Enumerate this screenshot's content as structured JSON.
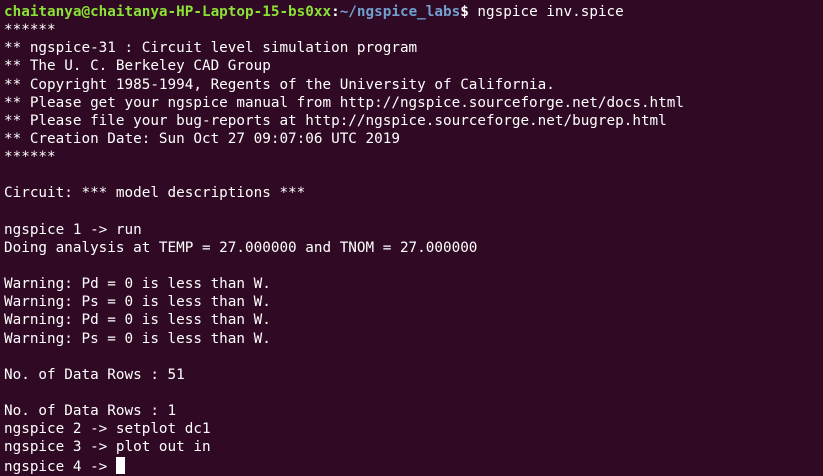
{
  "shell": {
    "user_host": "chaitanya@chaitanya-HP-Laptop-15-bs0xx",
    "separator": ":",
    "path": "~/ngspice_labs",
    "dollar": "$",
    "command": " ngspice inv.spice"
  },
  "output_lines": [
    "******",
    "** ngspice-31 : Circuit level simulation program",
    "** The U. C. Berkeley CAD Group",
    "** Copyright 1985-1994, Regents of the University of California.",
    "** Please get your ngspice manual from http://ngspice.sourceforge.net/docs.html",
    "** Please file your bug-reports at http://ngspice.sourceforge.net/bugrep.html",
    "** Creation Date: Sun Oct 27 09:07:06 UTC 2019",
    "******",
    "",
    "Circuit: *** model descriptions ***",
    "",
    "ngspice 1 -> run",
    "Doing analysis at TEMP = 27.000000 and TNOM = 27.000000",
    "",
    "Warning: Pd = 0 is less than W.",
    "Warning: Ps = 0 is less than W.",
    "Warning: Pd = 0 is less than W.",
    "Warning: Ps = 0 is less than W.",
    "",
    "No. of Data Rows : 51",
    "",
    "No. of Data Rows : 1",
    "ngspice 2 -> setplot dc1",
    "ngspice 3 -> plot out in"
  ],
  "current_prompt": "ngspice 4 -> "
}
